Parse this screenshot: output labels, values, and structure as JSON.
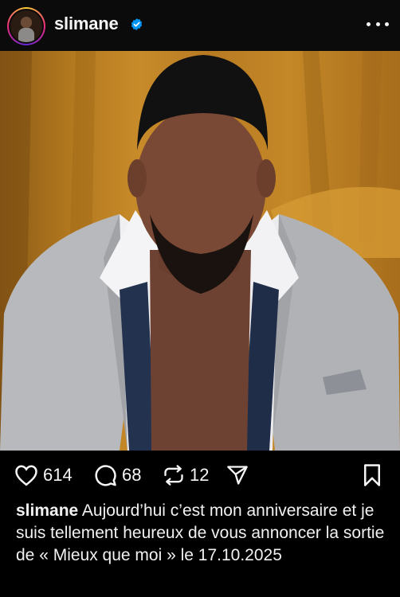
{
  "header": {
    "username": "slimane",
    "verified": true,
    "avatar_icon": "profile-avatar",
    "more_icon": "more-horizontal-icon"
  },
  "post": {
    "image_description_icon": "post-photo"
  },
  "actions": {
    "likes": "614",
    "comments": "68",
    "reposts": "12",
    "icons": [
      "heart-icon",
      "comment-icon",
      "repost-icon",
      "share-icon",
      "bookmark-icon"
    ]
  },
  "caption": {
    "username": "slimane",
    "text": " Aujourd’hui c’est mon anniversaire et je suis tellement heureux de vous annoncer la sortie de « Mieux que moi » le 17.10.2025"
  },
  "colors": {
    "background": "#000000",
    "verified": "#0095f6",
    "text": "#f5f5f5"
  }
}
